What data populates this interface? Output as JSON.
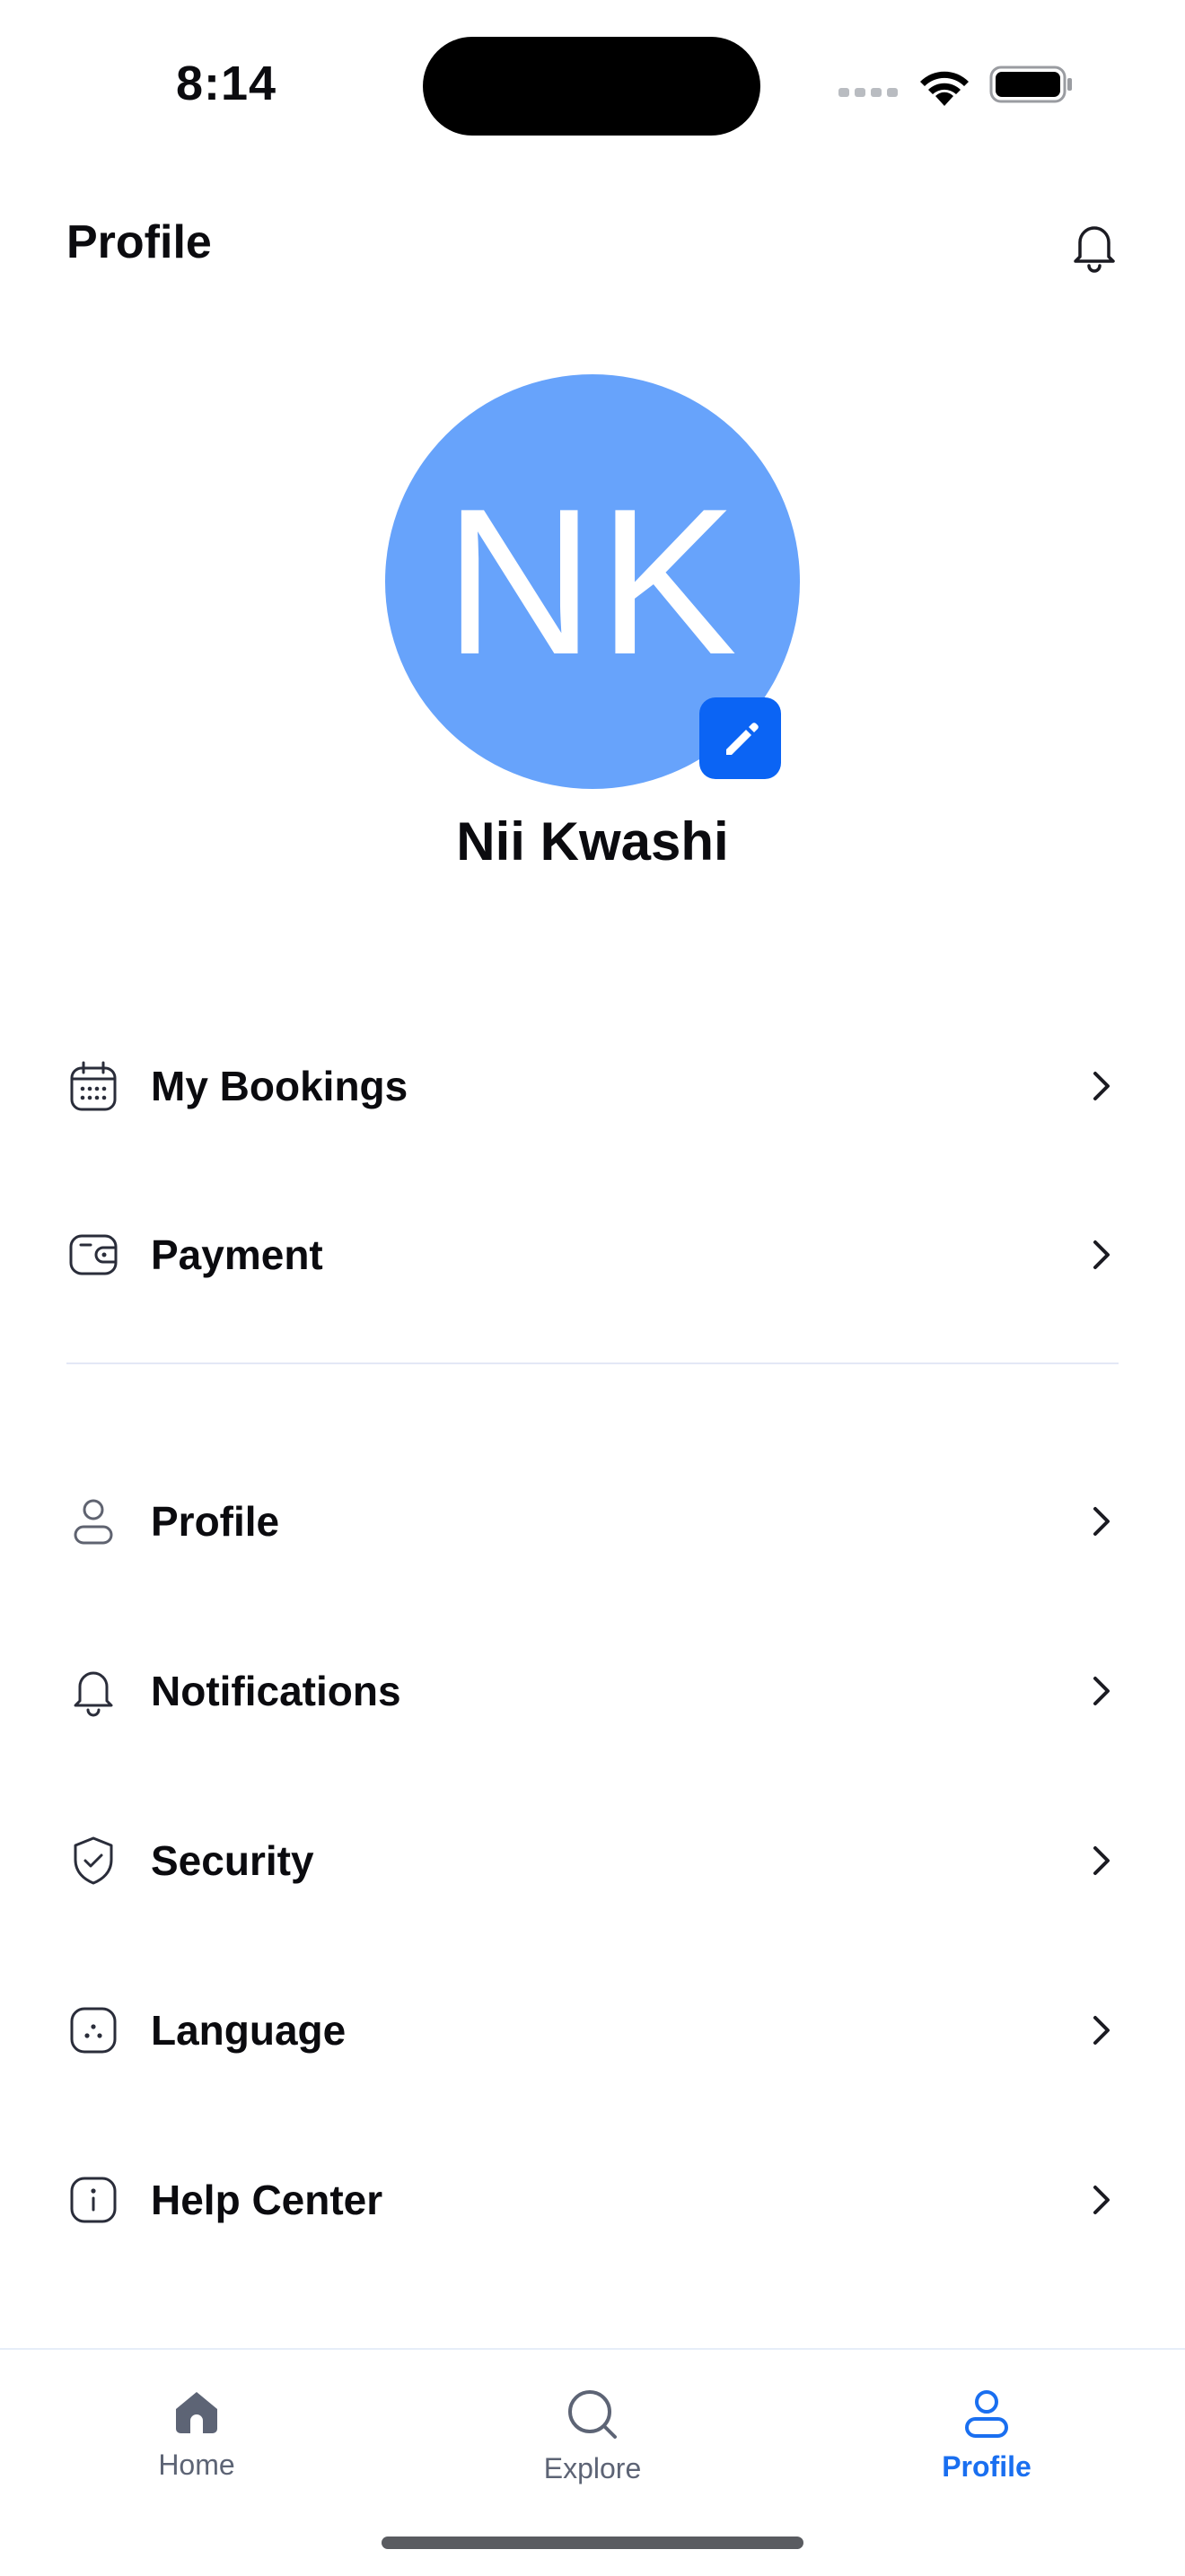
{
  "status_bar": {
    "time": "8:14"
  },
  "header": {
    "title": "Profile"
  },
  "profile": {
    "initials": "NK",
    "name": "Nii Kwashi",
    "avatar_color": "#67a3fb",
    "edit_color": "#0b64f4"
  },
  "menu": {
    "group1": [
      {
        "label": "My Bookings",
        "icon": "calendar-icon"
      },
      {
        "label": "Payment",
        "icon": "wallet-icon"
      }
    ],
    "group2": [
      {
        "label": "Profile",
        "icon": "user-icon"
      },
      {
        "label": "Notifications",
        "icon": "bell-icon"
      },
      {
        "label": "Security",
        "icon": "shield-check-icon"
      },
      {
        "label": "Language",
        "icon": "language-icon"
      },
      {
        "label": "Help Center",
        "icon": "info-icon"
      }
    ]
  },
  "tabbar": {
    "tabs": [
      {
        "label": "Home",
        "icon": "home-icon",
        "active": false
      },
      {
        "label": "Explore",
        "icon": "search-icon",
        "active": false
      },
      {
        "label": "Profile",
        "icon": "user-icon",
        "active": true
      }
    ],
    "active_color": "#1a6ff0"
  }
}
